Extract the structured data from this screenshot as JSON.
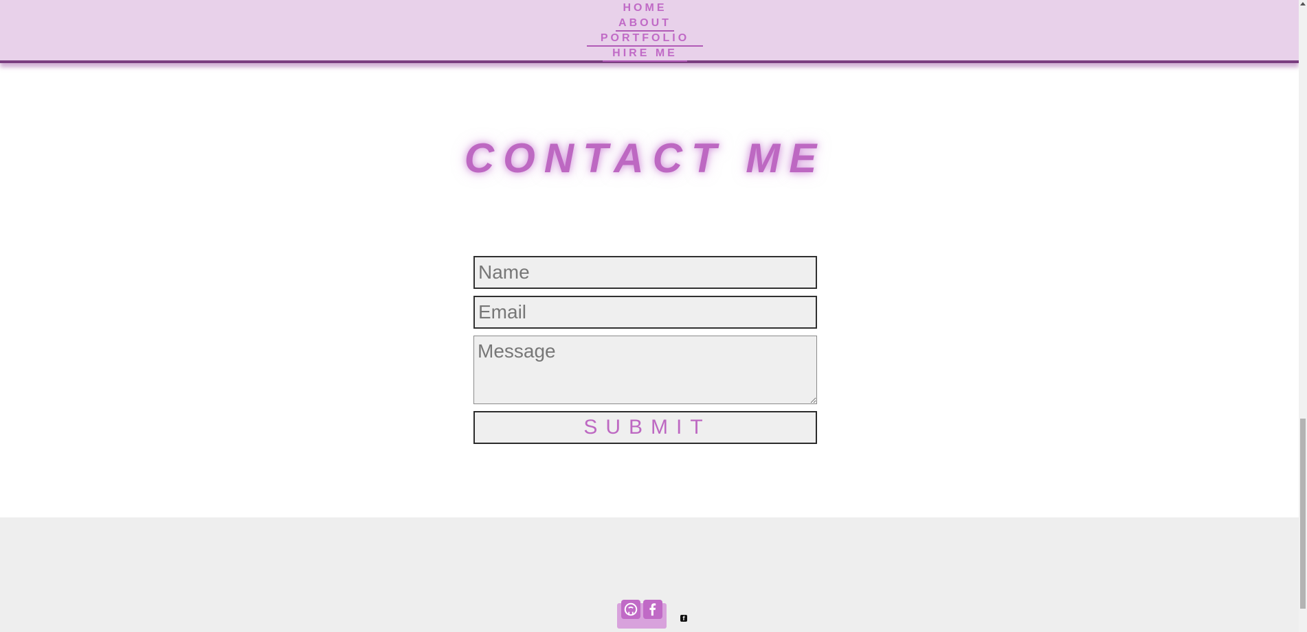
{
  "nav": {
    "home": "HOME",
    "about": "ABOUT",
    "portfolio": "PORTFOLIO",
    "hire_me": "HIRE ME"
  },
  "contact": {
    "title": "CONTACT ME",
    "name_placeholder": "Name",
    "email_placeholder": "Email",
    "message_placeholder": "Message",
    "submit_label": "SUBMIT"
  },
  "footer": {
    "icons": [
      "github-icon",
      "facebook-icon",
      "facebook-icon"
    ],
    "tiny_label": "f"
  },
  "colors": {
    "accent": "#bd68c2",
    "nav_bg": "#e8d1ea",
    "footer_bg": "#eeeeee"
  }
}
